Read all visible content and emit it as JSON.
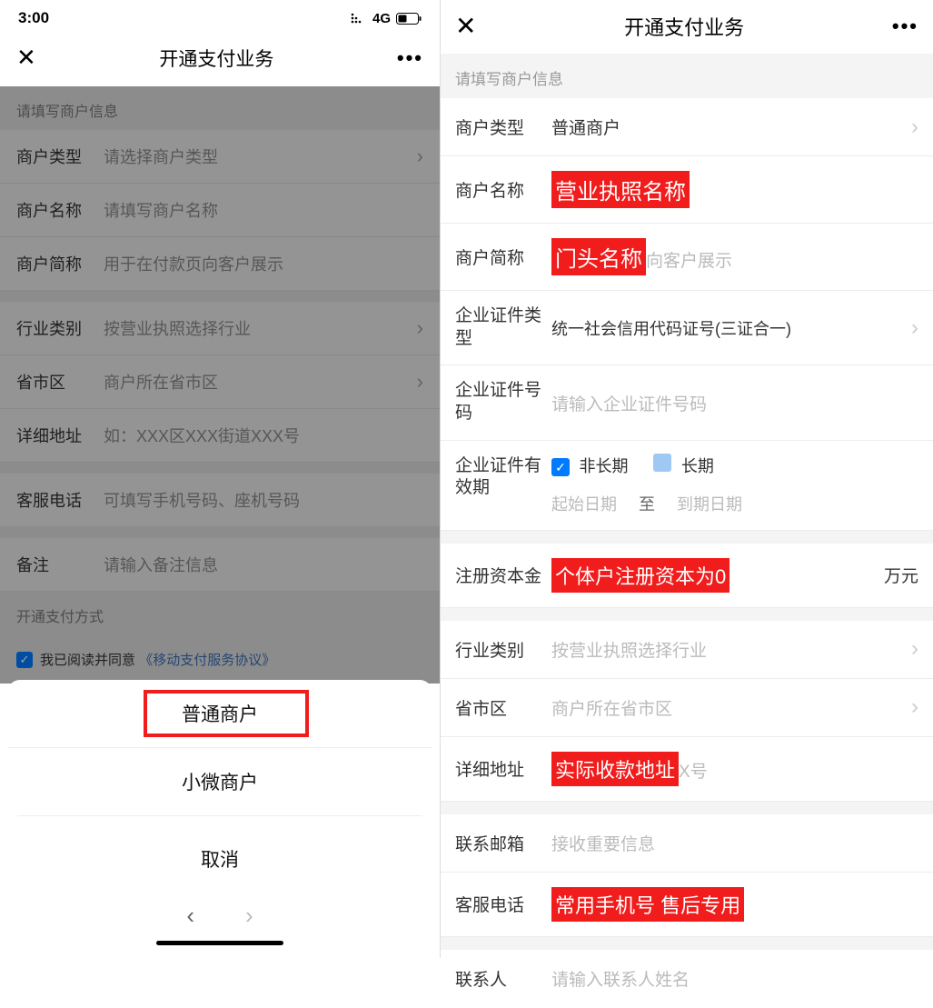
{
  "left": {
    "status_time": "3:00",
    "status_net": "4G",
    "nav_title": "开通支付业务",
    "section1_header": "请填写商户信息",
    "rows1": [
      {
        "label": "商户类型",
        "placeholder": "请选择商户类型",
        "chevron": true
      },
      {
        "label": "商户名称",
        "placeholder": "请填写商户名称",
        "chevron": false
      },
      {
        "label": "商户简称",
        "placeholder": "用于在付款页向客户展示",
        "chevron": false
      }
    ],
    "rows2": [
      {
        "label": "行业类别",
        "placeholder": "按营业执照选择行业",
        "chevron": true
      },
      {
        "label": "省市区",
        "placeholder": "商户所在省市区",
        "chevron": true
      },
      {
        "label": "详细地址",
        "placeholder": "如：XXX区XXX街道XXX号",
        "chevron": false
      }
    ],
    "rows3": [
      {
        "label": "客服电话",
        "placeholder": "可填写手机号码、座机号码",
        "chevron": false
      }
    ],
    "rows4": [
      {
        "label": "备注",
        "placeholder": "请输入备注信息",
        "chevron": false
      }
    ],
    "section_pay_header": "开通支付方式",
    "agree_text": "我已阅读并同意",
    "agree_link": "《移动支付服务协议》",
    "sheet_opt1": "普通商户",
    "sheet_opt2": "小微商户",
    "sheet_cancel": "取消"
  },
  "right": {
    "nav_title": "开通支付业务",
    "section_header": "请填写商户信息",
    "row_type_label": "商户类型",
    "row_type_value": "普通商户",
    "row_name_label": "商户名称",
    "row_name_hl": "营业执照名称",
    "row_short_label": "商户简称",
    "row_short_hl": "门头名称",
    "row_short_ph_tail": "向客户展示",
    "row_certtype_label": "企业证件类型",
    "row_certtype_value": "统一社会信用代码证号(三证合一)",
    "row_certno_label": "企业证件号码",
    "row_certno_ph": "请输入企业证件号码",
    "row_valid_label": "企业证件有效期",
    "valid_opt1": "非长期",
    "valid_opt2": "长期",
    "valid_start": "起始日期",
    "valid_to": "至",
    "valid_end": "到期日期",
    "row_capital_label": "注册资本金",
    "row_capital_hl": "个体户注册资本为0",
    "row_capital_suffix": "万元",
    "row_industry_label": "行业类别",
    "row_industry_ph": "按营业执照选择行业",
    "row_region_label": "省市区",
    "row_region_ph": "商户所在省市区",
    "row_addr_label": "详细地址",
    "row_addr_hl": "实际收款地址",
    "row_addr_ph_tail": "X号",
    "row_email_label": "联系邮箱",
    "row_email_ph": "接收重要信息",
    "row_phone_label": "客服电话",
    "row_phone_hl": "常用手机号 售后专用",
    "row_contact_label": "联系人",
    "row_contact_ph": "请输入联系人姓名"
  }
}
